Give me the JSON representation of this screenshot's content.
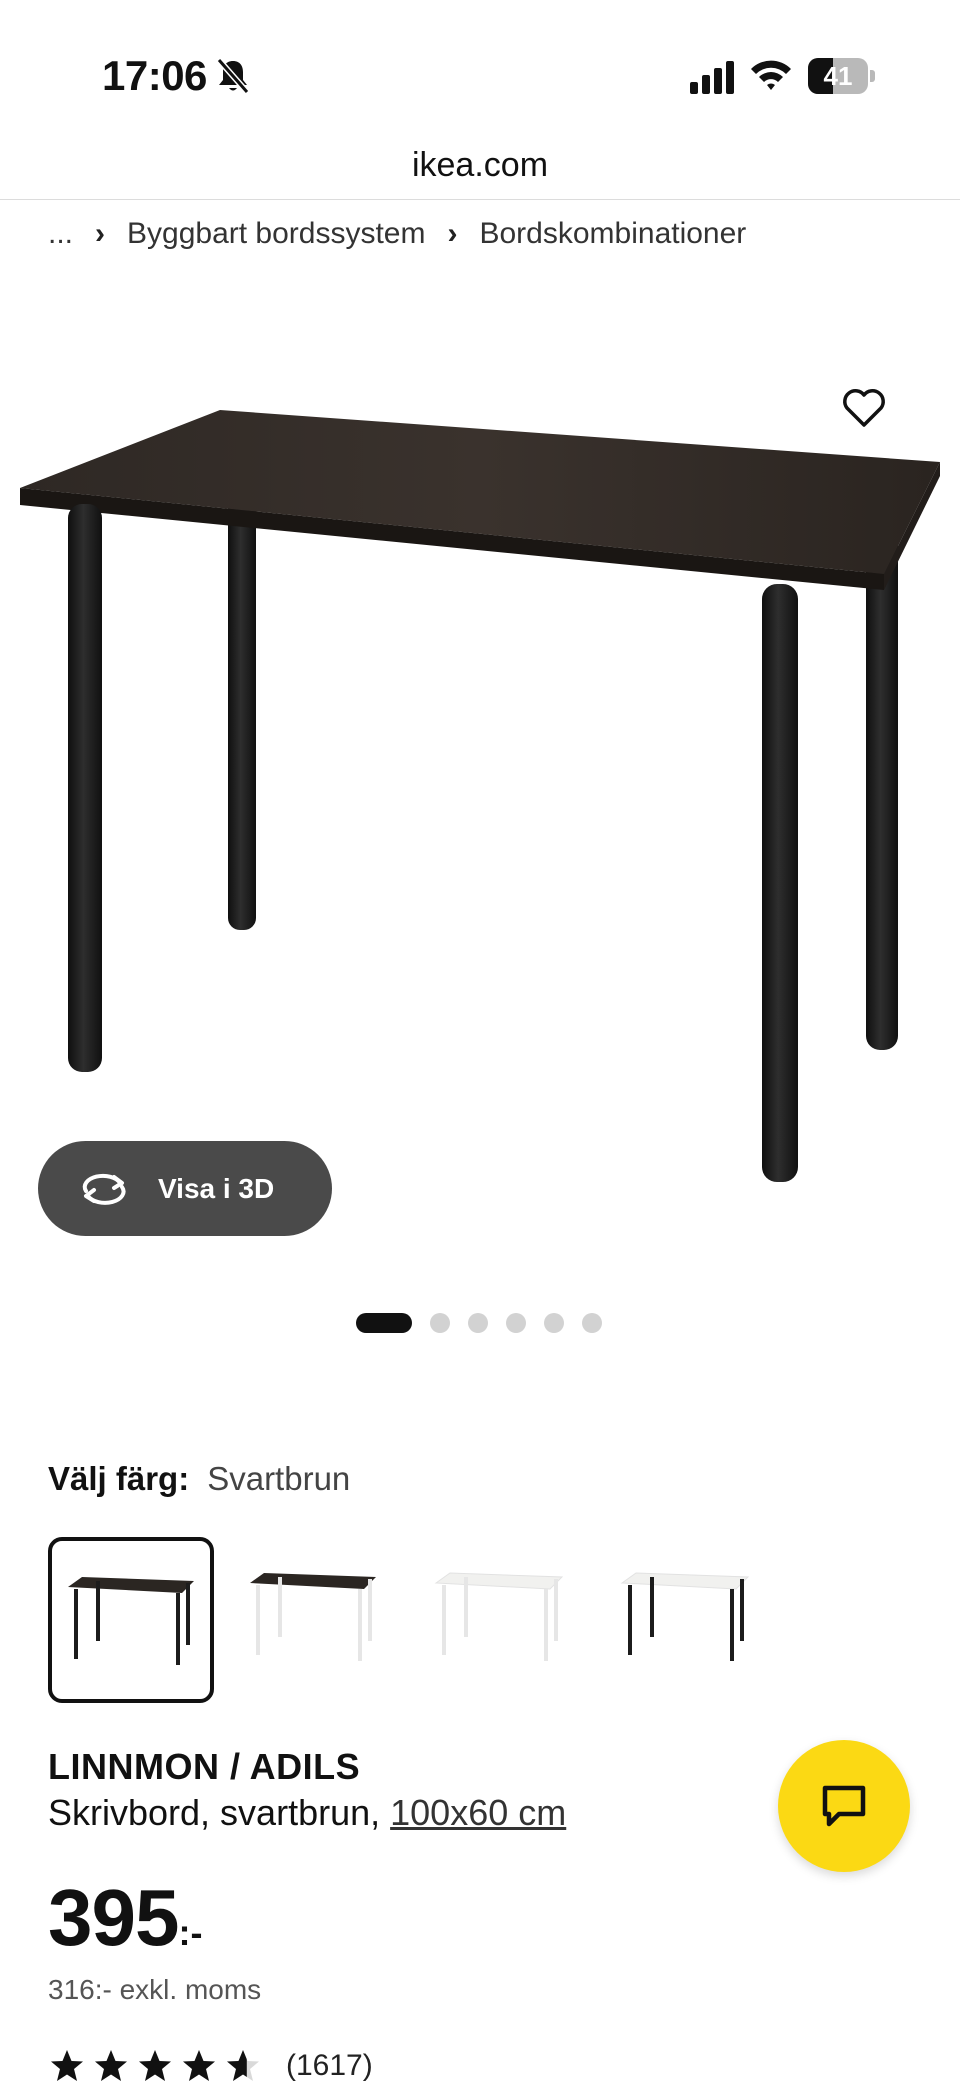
{
  "status_bar": {
    "time": "17:06",
    "battery_level": "41",
    "battery_fraction": 0.41
  },
  "browser": {
    "url": "ikea.com"
  },
  "breadcrumb": {
    "ellipsis": "...",
    "items": [
      "Byggbart bordssystem",
      "Bordskombinationer"
    ],
    "separator": "›"
  },
  "gallery": {
    "view_3d_label": "Visa i 3D",
    "image_count": 6,
    "active_index": 0
  },
  "color_picker": {
    "label": "Välj färg:",
    "selected_value": "Svartbrun",
    "options": [
      {
        "top": "#2b2622",
        "legs": "#1c1c1c"
      },
      {
        "top": "#2b2622",
        "legs": "#f2f2f2"
      },
      {
        "top": "#f4f4f2",
        "legs": "#f2f2f2"
      },
      {
        "top": "#f4f4f2",
        "legs": "#1c1c1c"
      }
    ],
    "selected_index": 0
  },
  "product": {
    "name": "LINNMON / ADILS",
    "description": "Skrivbord, svartbrun,",
    "size": "100x60 cm",
    "price": "395",
    "price_suffix": ":-",
    "price_ex_vat": "316:- exkl. moms",
    "rating": 4.6,
    "rating_count": "(1617)"
  },
  "colors": {
    "chat_yellow": "#fbd914",
    "dark_button": "#4a4a4a",
    "table_top": "#2b2622"
  },
  "icons": {
    "favorite": "heart-icon",
    "view3d": "rotate-3d-icon",
    "chat": "chat-bubble-icon",
    "star": "star-icon"
  }
}
